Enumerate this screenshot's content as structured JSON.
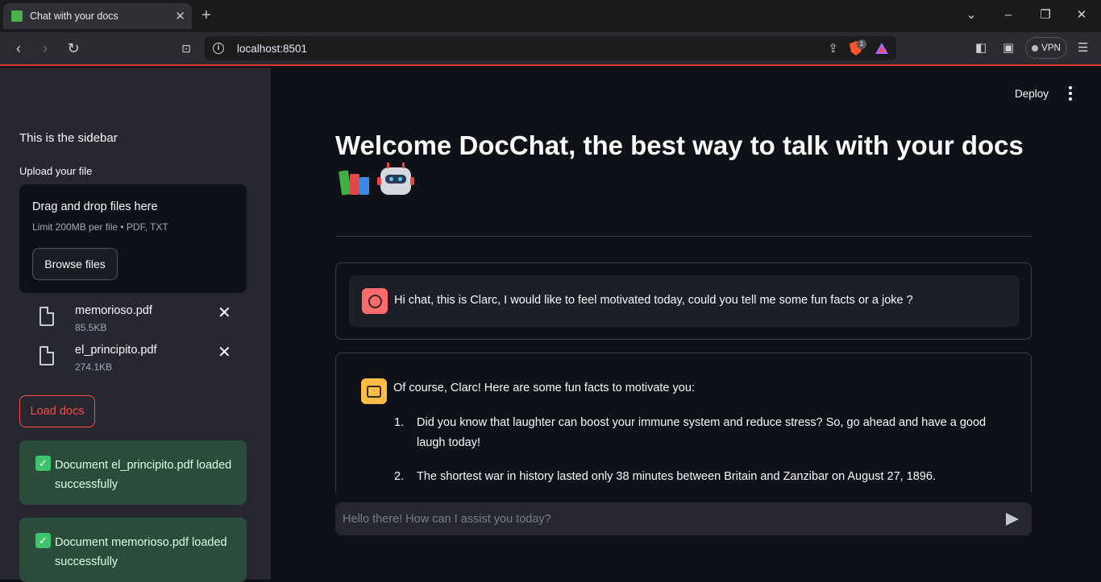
{
  "browser": {
    "tab_title": "Chat with your docs",
    "tab_close": "✕",
    "new_tab": "+",
    "url": "localhost:8501",
    "shield_badge": "1",
    "vpn_label": "VPN",
    "back": "‹",
    "forward": "›",
    "reload": "↻"
  },
  "sidebar": {
    "title": "This is the sidebar",
    "upload_label": "Upload your file",
    "dropzone_title": "Drag and drop files here",
    "dropzone_limit": "Limit 200MB per file • PDF, TXT",
    "browse_label": "Browse files",
    "files": [
      {
        "name": "memorioso.pdf",
        "size": "85.5KB"
      },
      {
        "name": "el_principito.pdf",
        "size": "274.1KB"
      }
    ],
    "remove_glyph": "✕",
    "load_label": "Load docs",
    "alerts": [
      {
        "text": "Document el_principito.pdf loaded successfully"
      },
      {
        "text": "Document memorioso.pdf loaded successfully"
      }
    ],
    "check_glyph": "✓"
  },
  "main": {
    "deploy_label": "Deploy",
    "heading": "Welcome DocChat, the best way to talk with your docs",
    "messages": {
      "user": "Hi chat, this is Clarc, I would like to feel motivated today, could you tell me some fun facts or a joke ?",
      "assistant_intro": "Of course, Clarc! Here are some fun facts to motivate you:",
      "assistant_items": [
        {
          "num": "1.",
          "text": "Did you know that laughter can boost your immune system and reduce stress? So, go ahead and have a good laugh today!"
        },
        {
          "num": "2.",
          "text": "The shortest war in history lasted only 38 minutes between Britain and Zanzibar on August 27, 1896."
        }
      ]
    },
    "input_placeholder": "Hello there! How can I assist you today?"
  },
  "colors": {
    "accent": "#ff4b4b",
    "sidebar_bg": "#262730",
    "main_bg": "#0e1117",
    "success_bg": "#2c4c3b",
    "user_avatar": "#ff6b6b",
    "bot_avatar": "#ffbd45"
  },
  "icons": [
    "book-icon",
    "close-icon",
    "plus-icon",
    "back-icon",
    "forward-icon",
    "reload-icon",
    "bookmark-icon",
    "info-icon",
    "share-icon",
    "brave-shield-icon",
    "bat-icon",
    "sidebar-icon",
    "wallet-icon",
    "menu-icon",
    "file-icon",
    "check-icon",
    "kebab-icon",
    "books-emoji",
    "robot-emoji",
    "user-avatar-icon",
    "bot-avatar-icon",
    "send-icon"
  ]
}
